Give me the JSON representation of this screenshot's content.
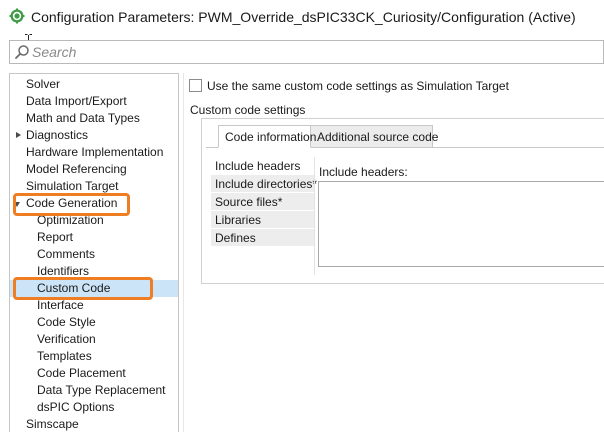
{
  "window": {
    "title": "Configuration Parameters: PWM_Override_dsPIC33CK_Curiosity/Configuration (Active)",
    "app_icon": "simulink-gear-icon"
  },
  "search": {
    "placeholder": "Search",
    "value": ""
  },
  "tree": {
    "items": [
      {
        "label": "Solver",
        "expanded": null
      },
      {
        "label": "Data Import/Export",
        "expanded": null
      },
      {
        "label": "Math and Data Types",
        "expanded": null
      },
      {
        "label": "Diagnostics",
        "expanded": false
      },
      {
        "label": "Hardware Implementation",
        "expanded": null
      },
      {
        "label": "Model Referencing",
        "expanded": null
      },
      {
        "label": "Simulation Target",
        "expanded": null
      },
      {
        "label": "Code Generation",
        "expanded": true
      },
      {
        "label": "Optimization",
        "expanded": null
      },
      {
        "label": "Report",
        "expanded": null
      },
      {
        "label": "Comments",
        "expanded": null
      },
      {
        "label": "Identifiers",
        "expanded": null
      },
      {
        "label": "Custom Code",
        "expanded": null
      },
      {
        "label": "Interface",
        "expanded": null
      },
      {
        "label": "Code Style",
        "expanded": null
      },
      {
        "label": "Verification",
        "expanded": null
      },
      {
        "label": "Templates",
        "expanded": null
      },
      {
        "label": "Code Placement",
        "expanded": null
      },
      {
        "label": "Data Type Replacement",
        "expanded": null
      },
      {
        "label": "dsPIC Options",
        "expanded": null
      },
      {
        "label": "Simscape",
        "expanded": null
      }
    ],
    "selected": "Custom Code",
    "highlighted": [
      "Code Generation",
      "Custom Code"
    ]
  },
  "main": {
    "checkbox_label": "Use the same custom code settings as Simulation Target",
    "checkbox_checked": false,
    "section_title": "Custom code settings",
    "tabs": [
      {
        "label": "Code information",
        "active": true
      },
      {
        "label": "Additional source code",
        "active": false
      }
    ],
    "categories": [
      {
        "label": "Include headers",
        "active": true
      },
      {
        "label": "Include directories*",
        "active": false
      },
      {
        "label": "Source files*",
        "active": false
      },
      {
        "label": "Libraries",
        "active": false
      },
      {
        "label": "Defines",
        "active": false
      }
    ],
    "include_headers_label": "Include headers:",
    "include_headers_value": ""
  },
  "colors": {
    "highlight_outline": "#ef7d22",
    "selection_bg": "#cce4f7"
  }
}
